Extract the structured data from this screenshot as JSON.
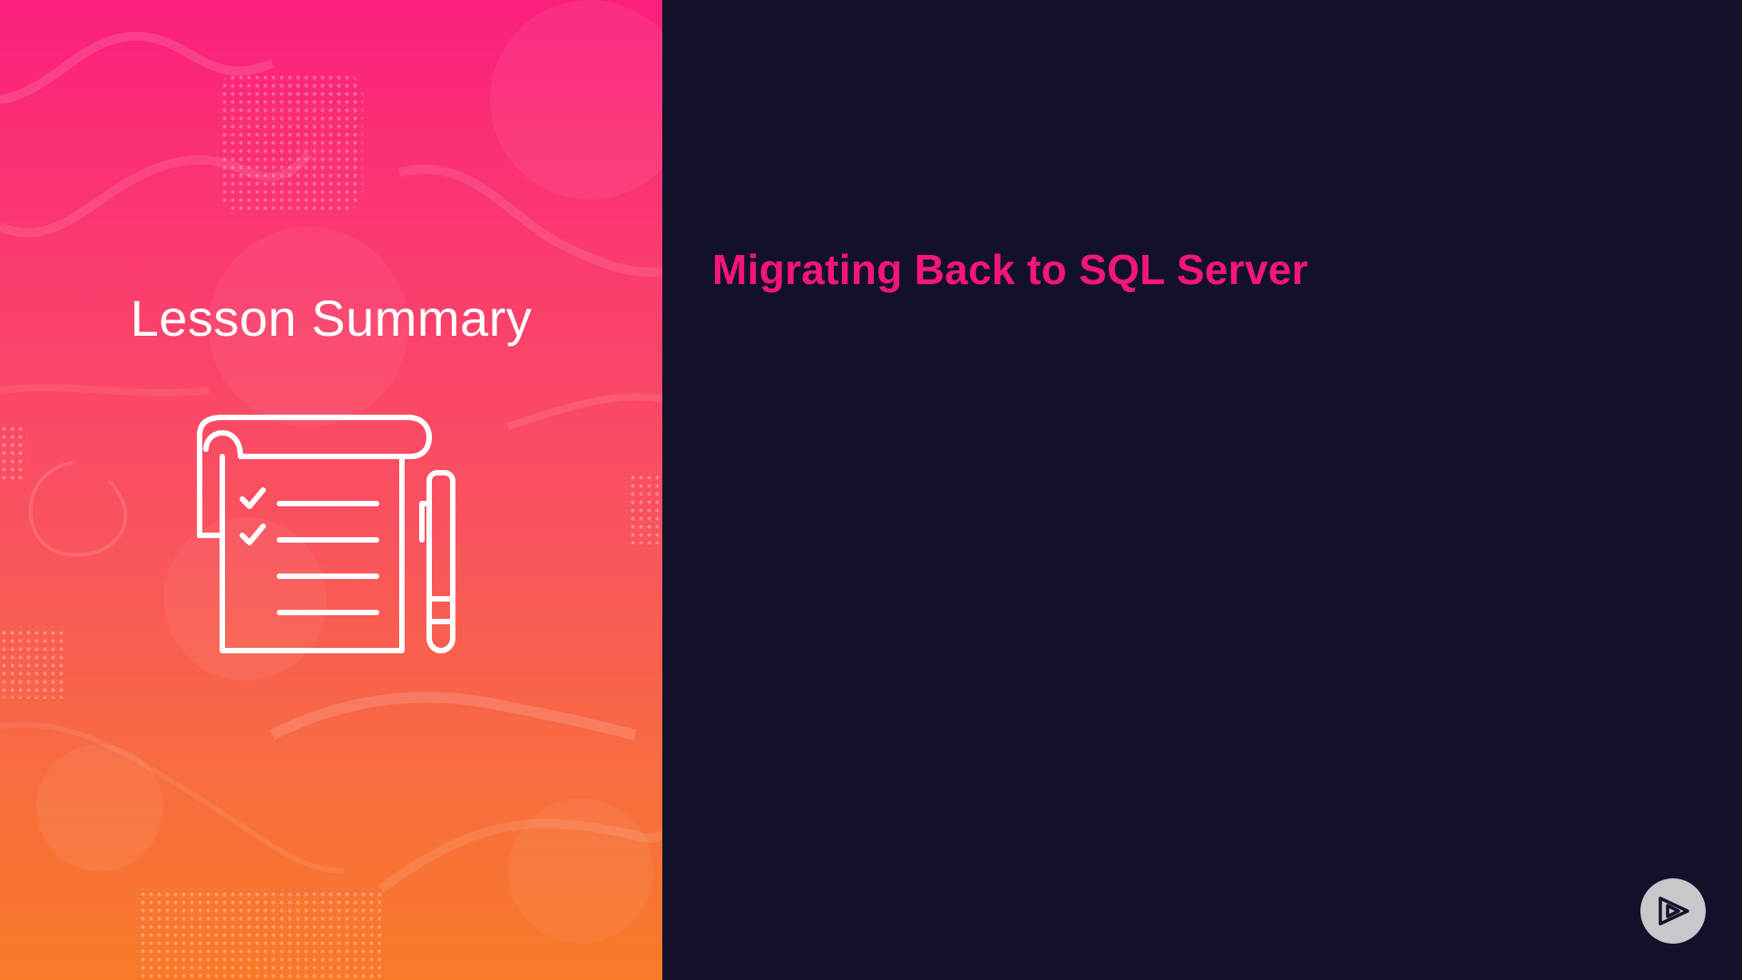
{
  "left_panel": {
    "title": "Lesson Summary",
    "icon": "checklist-notepad-pen-icon"
  },
  "right_panel": {
    "title": "Migrating Back to SQL Server"
  },
  "player": {
    "logo_icon": "play-logo-icon"
  },
  "colors": {
    "gradient_top": "#fb1f7c",
    "gradient_bottom": "#f87a28",
    "dark_background": "#13112a",
    "accent_pink": "#f5157c",
    "logo_bg": "#c7c7cc"
  }
}
